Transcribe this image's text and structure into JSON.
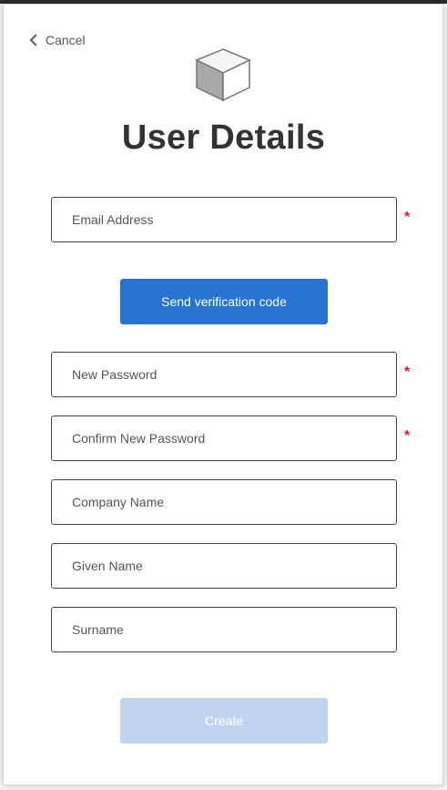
{
  "header": {
    "cancel_label": "Cancel",
    "title": "User Details"
  },
  "form": {
    "email": {
      "placeholder": "Email Address",
      "value": "",
      "required": "*"
    },
    "send_code_label": "Send verification code",
    "new_password": {
      "placeholder": "New Password",
      "value": "",
      "required": "*"
    },
    "confirm_password": {
      "placeholder": "Confirm New Password",
      "value": "",
      "required": "*"
    },
    "company": {
      "placeholder": "Company Name",
      "value": ""
    },
    "given_name": {
      "placeholder": "Given Name",
      "value": ""
    },
    "surname": {
      "placeholder": "Surname",
      "value": ""
    },
    "create_label": "Create"
  },
  "icons": {
    "back": "chevron-left-icon",
    "logo": "cube-logo-icon"
  },
  "colors": {
    "primary": "#2673d0",
    "disabled": "#bfd4ee",
    "required": "#e02020"
  }
}
